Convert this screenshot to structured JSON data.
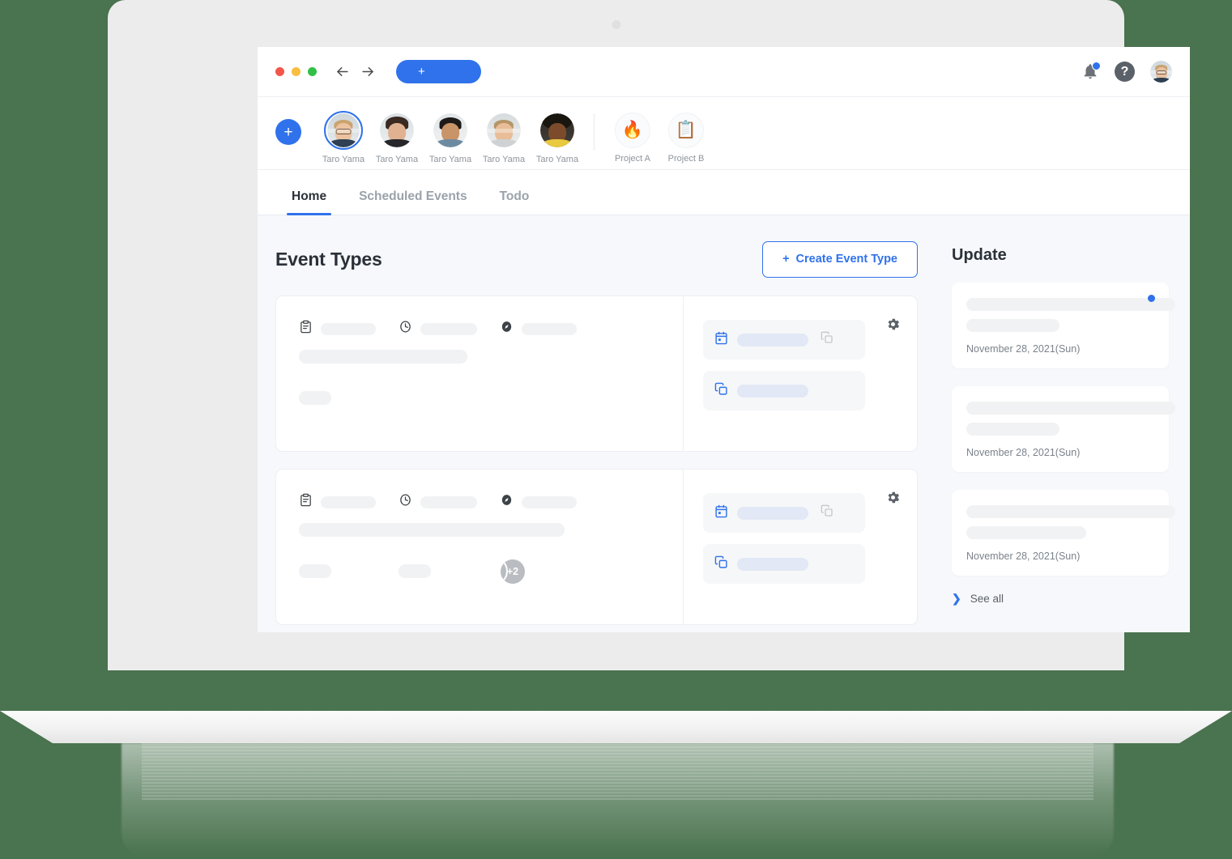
{
  "window": {
    "traffic_lights": [
      "close",
      "minimize",
      "maximize"
    ],
    "nav": {
      "back_icon": "arrow-left-icon",
      "forward_icon": "arrow-right-icon"
    },
    "new_tab_label": "+",
    "notification_icon": "bell-icon",
    "notification_badge": true,
    "help_icon": "question-mark-icon",
    "help_label": "?",
    "account_avatar": "user-avatar"
  },
  "people_strip": {
    "add_label": "+",
    "people": [
      {
        "name": "Taro Yama",
        "selected": true
      },
      {
        "name": "Taro Yama",
        "selected": false
      },
      {
        "name": "Taro Yama",
        "selected": false
      },
      {
        "name": "Taro Yama",
        "selected": false
      },
      {
        "name": "Taro Yama",
        "selected": false
      }
    ],
    "projects": [
      {
        "name": "Project A",
        "emoji": "🔥"
      },
      {
        "name": "Project B",
        "emoji": "📋"
      }
    ]
  },
  "tabs": [
    {
      "label": "Home",
      "active": true
    },
    {
      "label": "Scheduled Events",
      "active": false
    },
    {
      "label": "Todo",
      "active": false
    }
  ],
  "main": {
    "heading": "Event Types",
    "create_button": {
      "plus": "+",
      "label": "Create Event Type"
    },
    "event_cards": [
      {
        "meta_icons": [
          "clipboard-icon",
          "clock-icon",
          "compass-icon"
        ],
        "attendees_count": 1,
        "overflow_label": "",
        "actions": [
          {
            "icon": "calendar-icon",
            "copy_icon": "copy-icon"
          },
          {
            "icon": "duplicate-icon",
            "copy_icon": ""
          }
        ],
        "settings_icon": "gear-icon"
      },
      {
        "meta_icons": [
          "clipboard-icon",
          "clock-icon",
          "compass-icon"
        ],
        "attendees_count": 4,
        "overflow_label": "+2",
        "actions": [
          {
            "icon": "calendar-icon",
            "copy_icon": "copy-icon"
          },
          {
            "icon": "duplicate-icon",
            "copy_icon": ""
          }
        ],
        "settings_icon": "gear-icon"
      }
    ]
  },
  "update_panel": {
    "heading": "Update",
    "items": [
      {
        "date": "November 28, 2021(Sun)",
        "unread": true,
        "bar1_width": 258,
        "bar2_width": 115
      },
      {
        "date": "November 28, 2021(Sun)",
        "unread": false,
        "bar1_width": 258,
        "bar2_width": 115
      },
      {
        "date": "November 28, 2021(Sun)",
        "unread": false,
        "bar1_width": 258,
        "bar2_width": 148
      }
    ],
    "see_all": {
      "chevron": "❯",
      "label": "See all"
    }
  },
  "colors": {
    "accent": "#2f72eb",
    "background": "#4a734f",
    "screen_bg": "#f6f8fb",
    "text_dark": "#2b3138",
    "text_muted": "#8d959d"
  }
}
